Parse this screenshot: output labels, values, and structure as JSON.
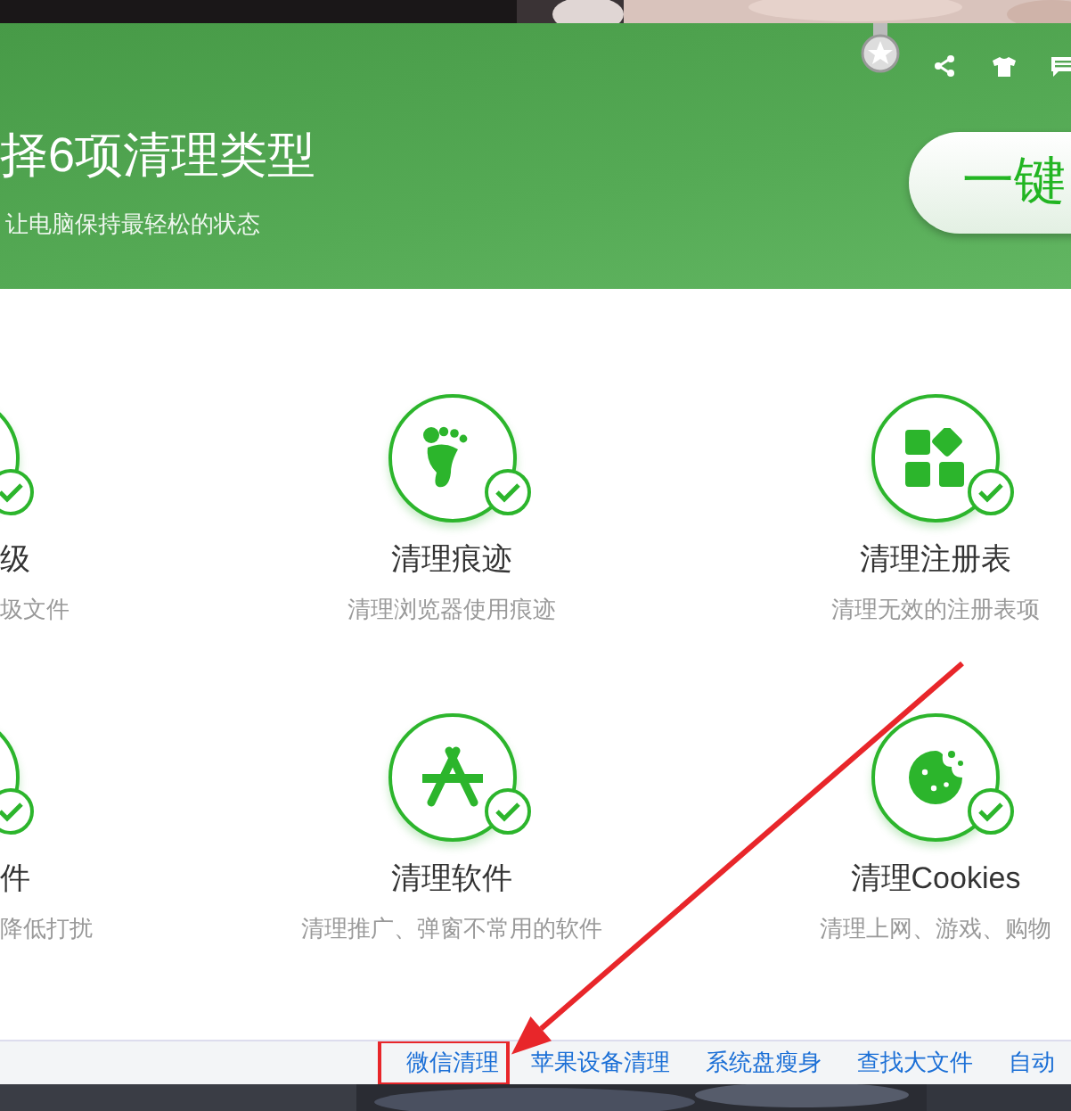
{
  "header": {
    "title": "择6项清理类型",
    "subtitle": "让电脑保持最轻松的状态",
    "scan_button": "一键"
  },
  "items": [
    {
      "kind": "partial",
      "title": "级",
      "desc": "圾文件",
      "checked": true
    },
    {
      "kind": "full",
      "title": "清理痕迹",
      "desc": "清理浏览器使用痕迹",
      "checked": true
    },
    {
      "kind": "full",
      "title": "清理注册表",
      "desc": "清理无效的注册表项",
      "checked": true
    },
    {
      "kind": "partial",
      "title": "件",
      "desc": "降低打扰",
      "checked": true
    },
    {
      "kind": "full",
      "title": "清理软件",
      "desc": "清理推广、弹窗不常用的软件",
      "checked": true
    },
    {
      "kind": "full",
      "title": "清理Cookies",
      "desc": "清理上网、游戏、购物",
      "checked": true
    }
  ],
  "footer_links": [
    {
      "label": "微信清理",
      "highlighted": true
    },
    {
      "label": "苹果设备清理",
      "highlighted": false
    },
    {
      "label": "系统盘瘦身",
      "highlighted": false
    },
    {
      "label": "查找大文件",
      "highlighted": false
    },
    {
      "label": "自动",
      "highlighted": false
    }
  ]
}
